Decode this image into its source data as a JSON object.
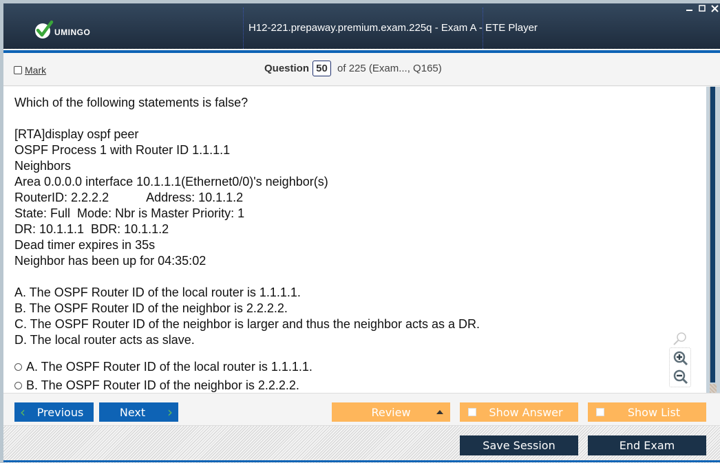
{
  "app": {
    "brand": "UMINGO",
    "title": "H12-221.prepaway.premium.exam.225q - Exam A - ETE Player",
    "window_controls": {
      "minimize": "_",
      "maximize": "□",
      "close": "X"
    }
  },
  "header": {
    "mark_label": "Mark",
    "question_label": "Question",
    "question_number": "50",
    "question_of": "of 225 (Exam..., Q165)"
  },
  "question": {
    "lines": [
      "Which of the following statements is false?",
      "",
      "[RTA]display ospf peer",
      "OSPF Process 1 with Router ID 1.1.1.1",
      "Neighbors",
      "Area 0.0.0.0 interface 10.1.1.1(Ethernet0/0)'s neighbor(s)",
      "RouterID: 2.2.2.2           Address: 10.1.1.2",
      "State: Full  Mode: Nbr is Master Priority: 1",
      "DR: 10.1.1.1  BDR: 10.1.1.2",
      "Dead timer expires in 35s",
      "Neighbor has been up for 04:35:02",
      "",
      "A. The OSPF Router ID of the local router is 1.1.1.1.",
      "B. The OSPF Router ID of the neighbor is 2.2.2.2.",
      "C. The OSPF Router ID of the neighbor is larger and thus the neighbor acts as a DR.",
      "D. The local router acts as slave."
    ],
    "choices": [
      {
        "label": "A. The OSPF Router ID of the local router is 1.1.1.1.",
        "selected": false
      },
      {
        "label": "B. The OSPF Router ID of the neighbor is 2.2.2.2.",
        "selected": false
      }
    ]
  },
  "zoom": {
    "icons": [
      "search-icon",
      "zoom-in-icon",
      "zoom-out-icon"
    ]
  },
  "toolbar": {
    "previous": "Previous",
    "next": "Next",
    "review": "Review",
    "show_answer": "Show Answer",
    "show_list": "Show List"
  },
  "footer": {
    "save_session": "Save Session",
    "end_exam": "End Exam"
  },
  "colors": {
    "title_bar": "#2a3b50",
    "accent_blue": "#0e63b5",
    "orange": "#feb65b",
    "dark_button": "#1b3249",
    "chevron_green": "#5cb85c"
  }
}
